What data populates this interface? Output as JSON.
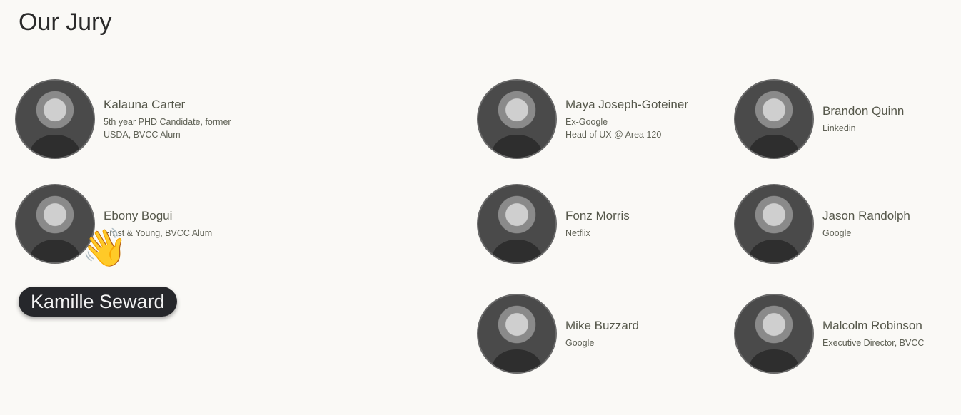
{
  "page": {
    "title": "Our Jury"
  },
  "jurors": [
    {
      "name": "Kalauna Carter",
      "lines": [
        "5th year PHD Candidate, former",
        "USDA, BVCC Alum"
      ]
    },
    {
      "name": "Ebony Bogui",
      "lines": [
        "Ernst & Young, BVCC Alum"
      ]
    },
    {
      "name": "Maya Joseph-Goteiner",
      "lines": [
        "Ex-Google",
        "Head of UX @ Area 120"
      ]
    },
    {
      "name": "Brandon Quinn",
      "lines": [
        "Linkedin"
      ]
    },
    {
      "name": "Fonz Morris",
      "lines": [
        "Netflix"
      ]
    },
    {
      "name": "Jason Randolph",
      "lines": [
        "Google"
      ]
    },
    {
      "name": "Mike Buzzard",
      "lines": [
        "Google"
      ]
    },
    {
      "name": "Malcolm Robinson",
      "lines": [
        "Executive Director, BVCC"
      ]
    }
  ],
  "overlay": {
    "participant_name": "Kamille Seward",
    "reaction_emoji": "👋",
    "reaction_icon": "waving-hand-icon"
  }
}
